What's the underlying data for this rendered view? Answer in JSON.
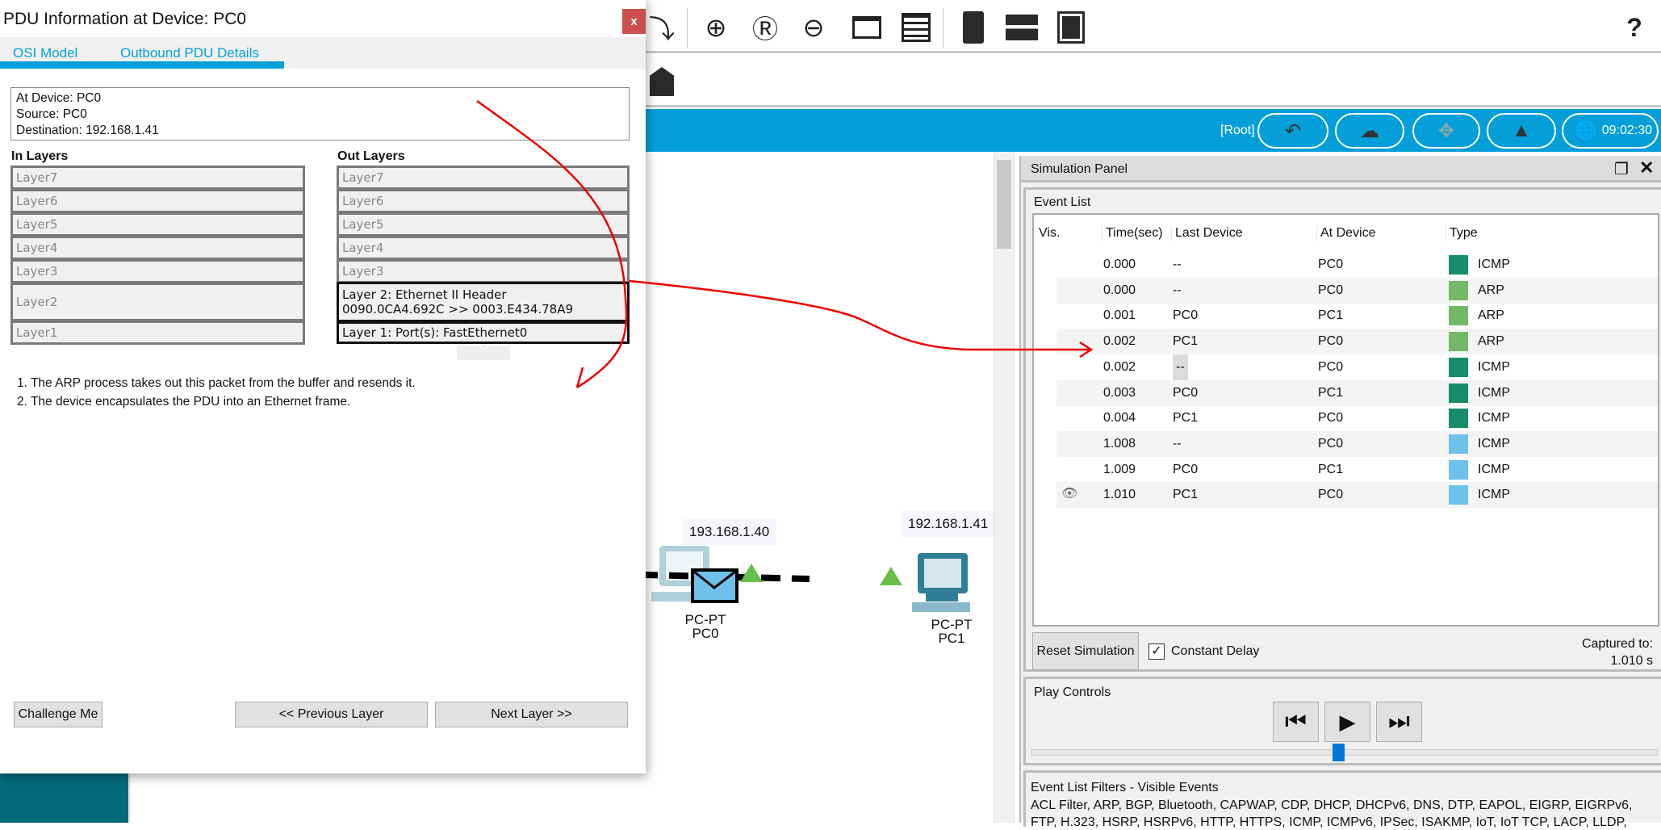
{
  "toolbar": {
    "icons": [
      "redo-icon",
      "zoom-in-icon",
      "zoom-reset-icon",
      "zoom-out-icon",
      "window-icon",
      "list-window-icon",
      "server-rack-icon",
      "switch-icon",
      "cloud-device-icon"
    ],
    "help": "?"
  },
  "toolbar2": {
    "icons": [
      "add-cluster-icon"
    ]
  },
  "bluebar": {
    "root": "[Root]",
    "clock": "09:02:30"
  },
  "network": {
    "pc0": {
      "ip": "193.168.1.40",
      "model": "PC-PT",
      "name": "PC0"
    },
    "pc1": {
      "ip": "192.168.1.41",
      "model": "PC-PT",
      "name": "PC1"
    },
    "link_color": "#000000",
    "port_status_color": "#6abf4b",
    "pdu_color": "#6ec1ea"
  },
  "dialog": {
    "title": "PDU Information at Device: PC0",
    "close": "x",
    "tabs": [
      {
        "label": "OSI Model",
        "active": true
      },
      {
        "label": "Outbound PDU Details",
        "active": false
      }
    ],
    "info": {
      "at_device": "At Device: PC0",
      "source": "Source: PC0",
      "destination": "Destination: 192.168.1.41"
    },
    "in_layers": {
      "title": "In Layers",
      "layers": [
        "Layer7",
        "Layer6",
        "Layer5",
        "Layer4",
        "Layer3",
        "Layer2",
        "Layer1"
      ]
    },
    "out_layers": {
      "title": "Out Layers",
      "layers": [
        "Layer7",
        "Layer6",
        "Layer5",
        "Layer4",
        "Layer3"
      ],
      "layer2": {
        "line1": "Layer 2: Ethernet II Header",
        "line2": "0090.0CA4.692C >> 0003.E434.78A9"
      },
      "layer1": "Layer 1: Port(s): FastEthernet0"
    },
    "description": [
      "1. The ARP process takes out this packet from the buffer and resends it.",
      "2. The device encapsulates the PDU into an Ethernet frame."
    ],
    "buttons": {
      "challenge": "Challenge Me",
      "previous": "<< Previous Layer",
      "next": "Next Layer >>"
    }
  },
  "simulation_panel": {
    "title": "Simulation Panel",
    "event_list": {
      "title": "Event List",
      "columns": [
        "Vis.",
        "Time(sec)",
        "Last Device",
        "At Device",
        "Type"
      ],
      "rows": [
        {
          "time": "0.000",
          "last": "--",
          "at": "PC0",
          "type": "ICMP",
          "color": "#178c6a"
        },
        {
          "time": "0.000",
          "last": "--",
          "at": "PC0",
          "type": "ARP",
          "color": "#72b866"
        },
        {
          "time": "0.001",
          "last": "PC0",
          "at": "PC1",
          "type": "ARP",
          "color": "#72b866"
        },
        {
          "time": "0.002",
          "last": "PC1",
          "at": "PC0",
          "type": "ARP",
          "color": "#72b866"
        },
        {
          "time": "0.002",
          "last": "--",
          "at": "PC0",
          "type": "ICMP",
          "color": "#178c6a",
          "selected": true
        },
        {
          "time": "0.003",
          "last": "PC0",
          "at": "PC1",
          "type": "ICMP",
          "color": "#178c6a"
        },
        {
          "time": "0.004",
          "last": "PC1",
          "at": "PC0",
          "type": "ICMP",
          "color": "#178c6a"
        },
        {
          "time": "1.008",
          "last": "--",
          "at": "PC0",
          "type": "ICMP",
          "color": "#6ec1ea"
        },
        {
          "time": "1.009",
          "last": "PC0",
          "at": "PC1",
          "type": "ICMP",
          "color": "#6ec1ea"
        },
        {
          "time": "1.010",
          "last": "PC1",
          "at": "PC0",
          "type": "ICMP",
          "color": "#6ec1ea",
          "visible_eye": true
        }
      ]
    },
    "reset": "Reset Simulation",
    "constant_delay": {
      "label": "Constant Delay",
      "checked": true
    },
    "captured_label": "Captured to:",
    "captured_value": "1.010 s",
    "play_controls": {
      "title": "Play Controls",
      "slider_percent": 49
    },
    "filters": {
      "title": "Event List Filters - Visible Events",
      "line1": "ACL Filter, ARP, BGP, Bluetooth, CAPWAP, CDP, DHCP, DHCPv6, DNS, DTP, EAPOL, EIGRP, EIGRPv6,",
      "line2": "FTP, H.323, HSRP, HSRPv6, HTTP, HTTPS, ICMP, ICMPv6, IPSec, ISAKMP, IoT, IoT TCP, LACP, LLDP,"
    }
  }
}
